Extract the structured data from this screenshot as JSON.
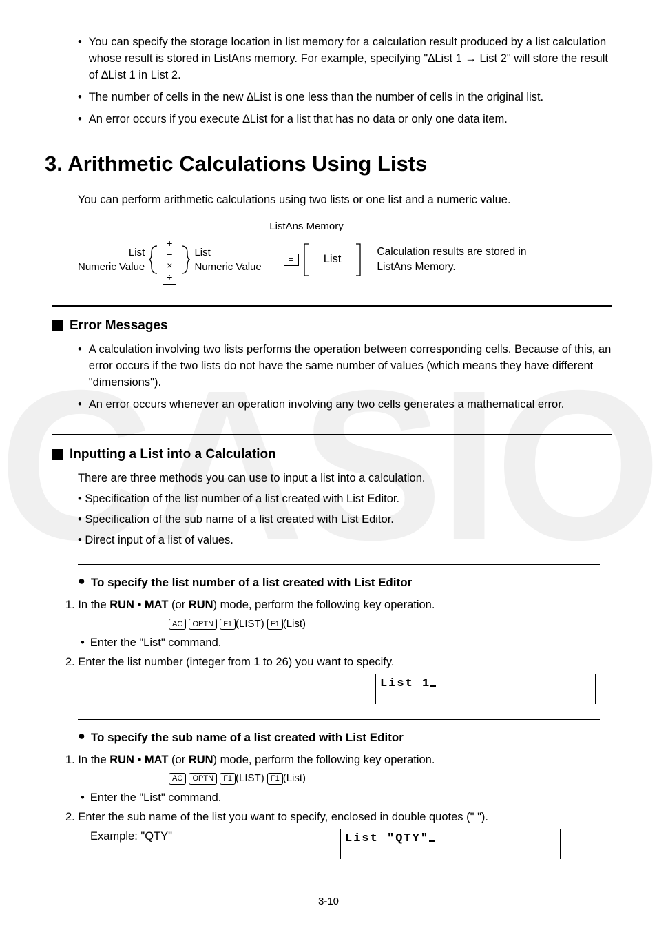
{
  "watermark": "CASIO",
  "top_bullets": [
    "You can specify the storage location in list memory for a calculation result produced by a list calculation whose result is stored in ListAns memory. For example, specifying \"∆List 1 → List 2\" will store the result of ∆List 1 in List 2.",
    "The number of cells in the new ∆List is one less than the number of cells in the original list.",
    "An error occurs if you execute ∆List for a list that has no data or only one data item."
  ],
  "heading": "3. Arithmetic Calculations Using Lists",
  "intro": "You can perform arithmetic calculations using two lists or one list and a numeric value.",
  "diagram": {
    "left1": "List",
    "left2": "Numeric Value",
    "ops": [
      "+",
      "−",
      "×",
      "÷"
    ],
    "mid1": "List",
    "mid2": "Numeric Value",
    "listans_title": "ListAns Memory",
    "list_label": "List",
    "desc": "Calculation results are stored in ListAns Memory."
  },
  "error_section": {
    "title": "Error Messages",
    "bullets": [
      "A calculation involving two lists performs the operation between corresponding cells. Because of this, an error occurs if the two lists do not have the same number of values (which means they have different \"dimensions\").",
      "An error occurs whenever an operation involving any two cells generates a mathematical error."
    ]
  },
  "input_section": {
    "title": "Inputting a List into a Calculation",
    "intro": "There are three methods you can use to input a list into a calculation.",
    "bullets": [
      "Specification of the list number of a list created with List Editor.",
      "Specification of the sub name of a list created with List Editor.",
      "Direct input of a list of values."
    ]
  },
  "spec_list_number": {
    "title": "To specify the list number of a list created with List Editor",
    "step1_prefix": "1. In the ",
    "mode1": "RUN • MAT",
    "mode_or": " (or ",
    "mode2": "RUN",
    "step1_suffix": ") mode, perform the following key operation.",
    "keys_suffix1": "(LIST)",
    "keys_suffix2": "(List)",
    "enter_cmd": "Enter the \"List\" command.",
    "step2": "2. Enter the list number (integer from 1 to 26) you want to specify.",
    "screen": "List 1"
  },
  "spec_sub_name": {
    "title": "To specify the sub name of a list created with List Editor",
    "step1_prefix": "1. In the ",
    "mode1": "RUN • MAT",
    "mode_or": " (or ",
    "mode2": "RUN",
    "step1_suffix": ") mode, perform the following key operation.",
    "keys_suffix1": "(LIST)",
    "keys_suffix2": "(List)",
    "enter_cmd": "Enter the \"List\" command.",
    "step2": "2. Enter the sub name of the list you want to specify, enclosed in double quotes (\" \").",
    "example_label": "Example: \"QTY\"",
    "screen": "List \"QTY\""
  },
  "footer": "3-10"
}
